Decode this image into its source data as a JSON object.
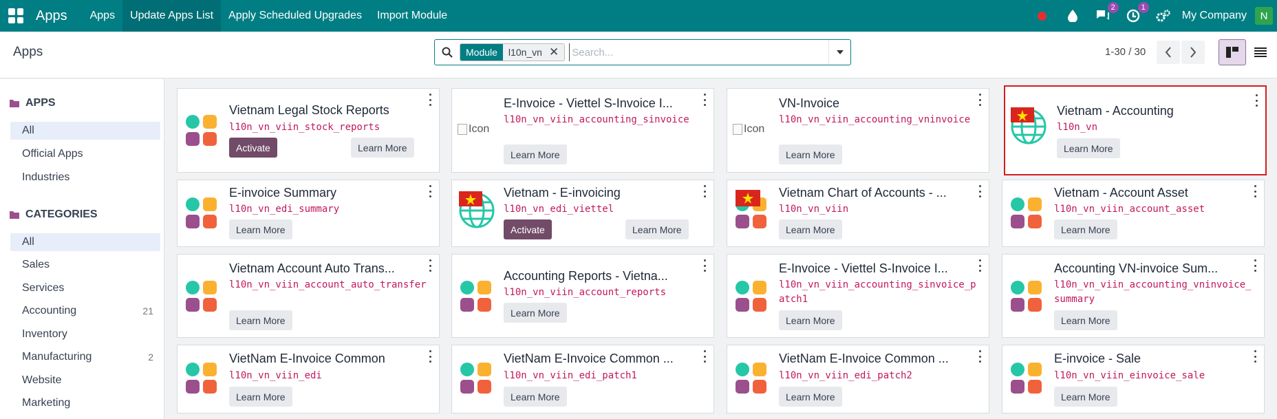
{
  "nav": {
    "brand": "Apps",
    "menu": [
      "Apps",
      "Update Apps List",
      "Apply Scheduled Upgrades",
      "Import Module"
    ],
    "chat_count": "2",
    "activity_count": "1",
    "company": "My Company",
    "avatar": "N"
  },
  "control": {
    "title": "Apps",
    "facet_label": "Module",
    "facet_value": "l10n_vn",
    "search_placeholder": "Search...",
    "pager": "1-30 / 30"
  },
  "sidebar": {
    "apps_heading": "APPS",
    "apps_items": [
      "All",
      "Official Apps",
      "Industries"
    ],
    "categories_heading": "CATEGORIES",
    "categories": [
      {
        "label": "All",
        "count": ""
      },
      {
        "label": "Sales",
        "count": ""
      },
      {
        "label": "Services",
        "count": ""
      },
      {
        "label": "Accounting",
        "count": "21"
      },
      {
        "label": "Inventory",
        "count": ""
      },
      {
        "label": "Manufacturing",
        "count": "2"
      },
      {
        "label": "Website",
        "count": ""
      },
      {
        "label": "Marketing",
        "count": ""
      }
    ]
  },
  "buttons": {
    "activate": "Activate",
    "learn_more": "Learn More",
    "icon_alt": "Icon"
  },
  "cards": [
    {
      "title": "Vietnam Legal Stock Reports",
      "code": "l10n_vn_viin_stock_reports"
    },
    {
      "title": "E-Invoice - Viettel S-Invoice I...",
      "code": "l10n_vn_viin_accounting_sinvoice"
    },
    {
      "title": "VN-Invoice",
      "code": "l10n_vn_viin_accounting_vninvoice"
    },
    {
      "title": "Vietnam - Accounting",
      "code": "l10n_vn"
    },
    {
      "title": "E-invoice Summary",
      "code": "l10n_vn_edi_summary"
    },
    {
      "title": "Vietnam - E-invoicing",
      "code": "l10n_vn_edi_viettel"
    },
    {
      "title": "Vietnam Chart of Accounts - ...",
      "code": "l10n_vn_viin"
    },
    {
      "title": "Vietnam - Account Asset",
      "code": "l10n_vn_viin_account_asset"
    },
    {
      "title": "Vietnam Account Auto Trans...",
      "code": "l10n_vn_viin_account_auto_transfer"
    },
    {
      "title": "Accounting Reports - Vietna...",
      "code": "l10n_vn_viin_account_reports"
    },
    {
      "title": "E-Invoice - Viettel S-Invoice I...",
      "code": "l10n_vn_viin_accounting_sinvoice_patch1"
    },
    {
      "title": "Accounting VN-invoice Sum...",
      "code": "l10n_vn_viin_accounting_vninvoice_summary"
    },
    {
      "title": "VietNam E-Invoice Common",
      "code": "l10n_vn_viin_edi"
    },
    {
      "title": "VietNam E-Invoice Common ...",
      "code": "l10n_vn_viin_edi_patch1"
    },
    {
      "title": "VietNam E-Invoice Common ...",
      "code": "l10n_vn_viin_edi_patch2"
    },
    {
      "title": "E-invoice - Sale",
      "code": "l10n_vn_viin_einvoice_sale"
    }
  ]
}
